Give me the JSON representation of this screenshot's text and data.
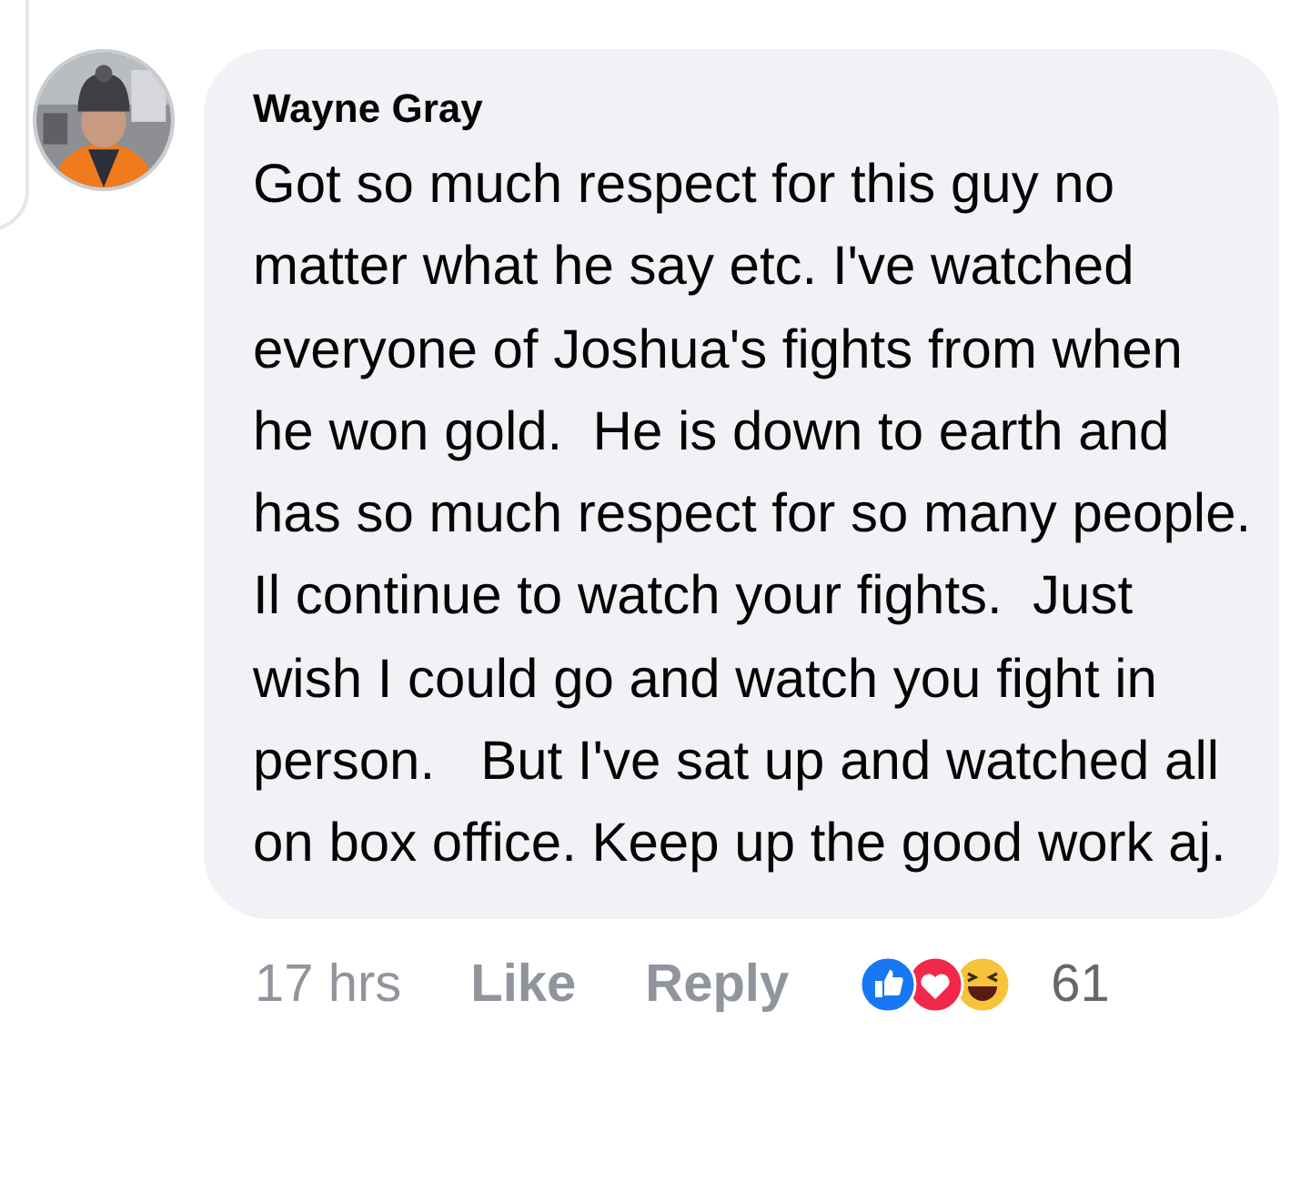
{
  "comment": {
    "author": "Wayne Gray",
    "text": "Got so much respect for this guy no matter what he say etc. I've watched everyone of Joshua's fights from when he won gold.  He is down to earth and has so much respect for so many people. Il continue to watch your fights.  Just wish I could go and watch you fight in person.   But I've sat up and watched all on box office. Keep up the good work aj."
  },
  "footer": {
    "time": "17 hrs",
    "actions": [
      {
        "label": "Like"
      },
      {
        "label": "Reply"
      }
    ],
    "reactions": [
      {
        "kind": "like"
      },
      {
        "kind": "love"
      },
      {
        "kind": "haha"
      }
    ],
    "reaction_count": "61"
  }
}
